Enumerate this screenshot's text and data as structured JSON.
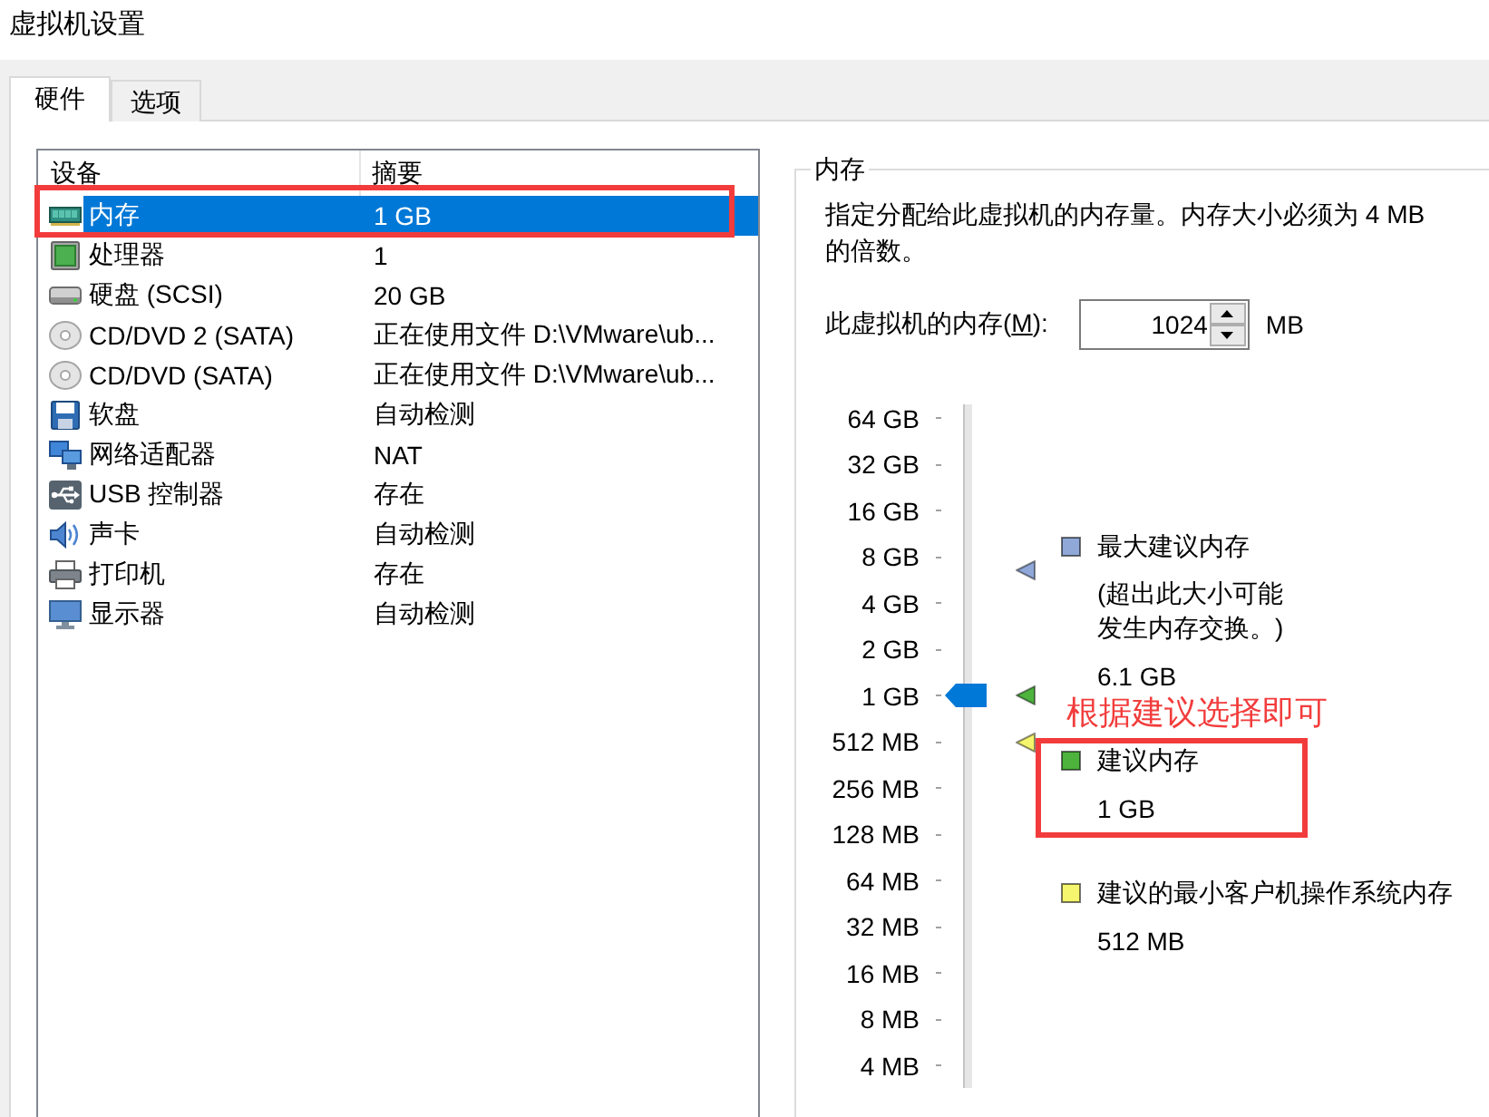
{
  "window": {
    "title": "虚拟机设置"
  },
  "tabs": [
    {
      "label": "硬件",
      "selected": true
    },
    {
      "label": "选项",
      "selected": false
    }
  ],
  "device_list": {
    "columns": [
      "设备",
      "摘要"
    ],
    "devices": [
      {
        "kind": "memory",
        "name": "内存",
        "summary": "1 GB",
        "selected": true,
        "highlighted": true
      },
      {
        "kind": "cpu",
        "name": "处理器",
        "summary": "1",
        "selected": false,
        "highlighted": false
      },
      {
        "kind": "disk",
        "name": "硬盘 (SCSI)",
        "summary": "20 GB",
        "selected": false,
        "highlighted": false
      },
      {
        "kind": "cdrom",
        "name": "CD/DVD 2 (SATA)",
        "summary": "正在使用文件 D:\\VMware\\ub...",
        "selected": false,
        "highlighted": false
      },
      {
        "kind": "cdrom",
        "name": "CD/DVD (SATA)",
        "summary": "正在使用文件 D:\\VMware\\ub...",
        "selected": false,
        "highlighted": false
      },
      {
        "kind": "floppy",
        "name": "软盘",
        "summary": "自动检测",
        "selected": false,
        "highlighted": false
      },
      {
        "kind": "network",
        "name": "网络适配器",
        "summary": "NAT",
        "selected": false,
        "highlighted": false
      },
      {
        "kind": "usb",
        "name": "USB 控制器",
        "summary": "存在",
        "selected": false,
        "highlighted": false
      },
      {
        "kind": "sound",
        "name": "声卡",
        "summary": "自动检测",
        "selected": false,
        "highlighted": false
      },
      {
        "kind": "printer",
        "name": "打印机",
        "summary": "存在",
        "selected": false,
        "highlighted": false
      },
      {
        "kind": "display",
        "name": "显示器",
        "summary": "自动检测",
        "selected": false,
        "highlighted": false
      }
    ]
  },
  "memory": {
    "title": "内存",
    "description": "指定分配给此虚拟机的内存量。内存大小必须为 4 MB 的倍数。",
    "size_field": {
      "label_prefix": "此虚拟机的内存(",
      "access_key": "M",
      "label_suffix": "):",
      "value": "1024",
      "unit": "MB"
    },
    "slider": {
      "scale": [
        "64 GB",
        "32 GB",
        "16 GB",
        "8 GB",
        "4 GB",
        "2 GB",
        "1 GB",
        "512 MB",
        "256 MB",
        "128 MB",
        "64 MB",
        "32 MB",
        "16 MB",
        "8 MB",
        "4 MB"
      ],
      "level": 0.571,
      "markers": [
        {
          "color": "#8fa8d8",
          "level": 0.765
        },
        {
          "color": "#4db33d",
          "level": 0.571
        },
        {
          "color": "#f5f56e",
          "level": 0.5
        }
      ]
    },
    "legend": [
      {
        "label": "最大建议内存",
        "note": "(超出此大小可能发生内存交换。)",
        "value": "6.1 GB",
        "color": "#8fa8d8",
        "highlighted": false
      },
      {
        "label": "建议内存",
        "value": "1 GB",
        "color": "#4db33d",
        "highlighted": true,
        "annotation": "根据建议选择即可"
      },
      {
        "label": "建议的最小客户机操作系统内存",
        "value": "512 MB",
        "color": "#f5f56e",
        "highlighted": false
      }
    ]
  }
}
